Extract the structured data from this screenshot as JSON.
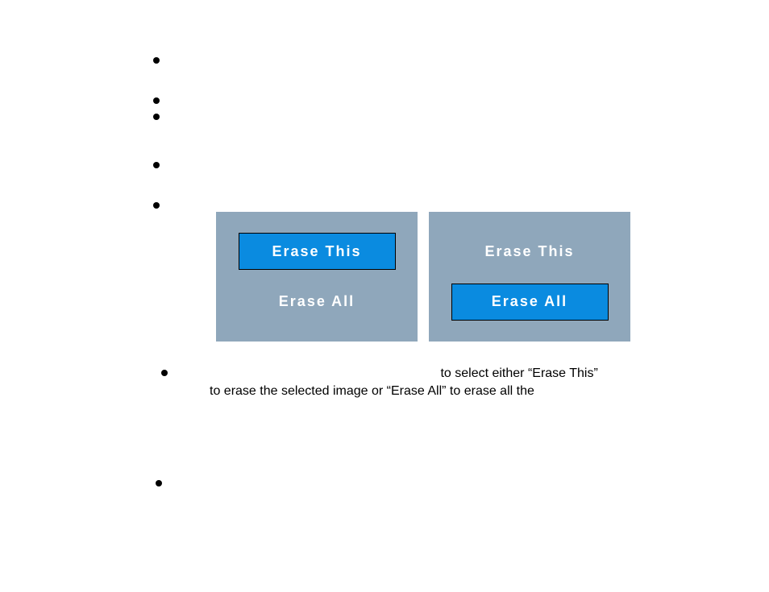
{
  "panels": {
    "left": {
      "erase_this": "Erase This",
      "erase_all": "Erase All"
    },
    "right": {
      "erase_this": "Erase This",
      "erase_all": "Erase All"
    }
  },
  "instruction": {
    "line1_part2": " to select either “Erase This”",
    "line2": "to erase the selected image or “Erase All” to erase all the"
  }
}
